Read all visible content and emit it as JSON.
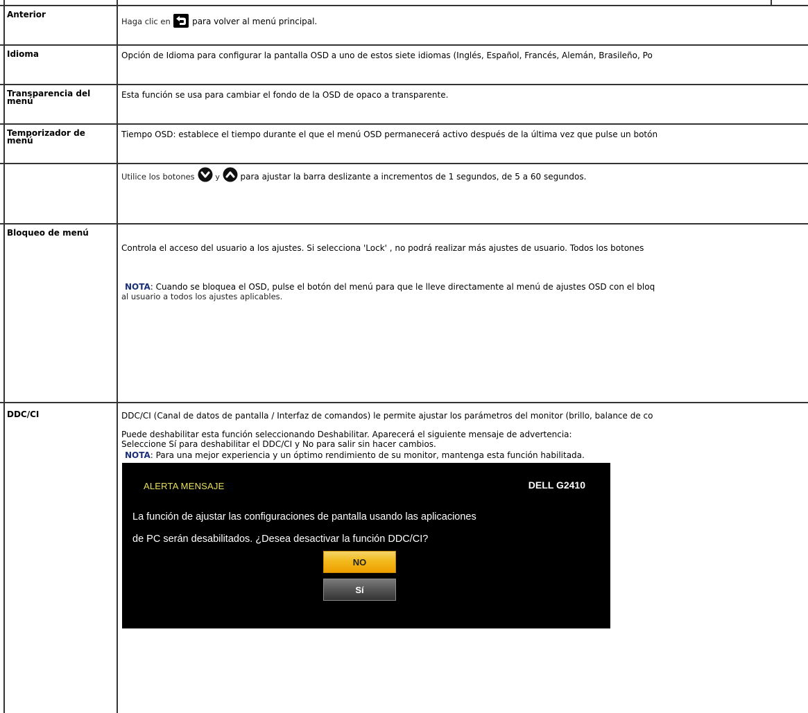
{
  "rows": {
    "anterior": {
      "label": "Anterior",
      "text_before": "Haga clic en",
      "text_after": "para volver al menú principal."
    },
    "idioma": {
      "label": "Idioma",
      "text": "Opción de Idioma para configurar la pantalla OSD a uno de estos siete idiomas (Inglés, Español, Francés, Alemán, Brasileño, Po"
    },
    "transparencia": {
      "label_line1": "Transparencia del",
      "label_line2": "menú",
      "text": "Esta función se usa para cambiar el fondo de la OSD de opaco a transparente."
    },
    "temporizador": {
      "label_line1": "Temporizador de",
      "label_line2": "menú",
      "text": "Tiempo OSD: establece el tiempo durante el que el menú OSD permanecerá activo después de la última vez que pulse un botón",
      "buttons_before": "Utilice los botones",
      "buttons_and": "y",
      "buttons_after": "para ajustar la barra deslizante a incrementos de 1 segundos, de 5 a 60 segundos."
    },
    "bloqueo": {
      "label": "Bloqueo de menú",
      "text": "Controla el acceso del usuario a los ajustes. Si selecciona 'Lock' , no podrá realizar más ajustes de usuario. Todos los botones",
      "note_keyword": "NOTA",
      "note_line1": ": Cuando se bloquea el OSD, pulse el botón del menú para que le lleve directamente al menú de ajustes OSD con el bloq",
      "note_line2": "al usuario a todos los ajustes aplicables."
    },
    "ddcci": {
      "label": "DDC/CI",
      "text": "DDC/CI (Canal de datos de pantalla / Interfaz de comandos) le permite ajustar los parámetros del monitor (brillo, balance de co",
      "disable_line1": "Puede deshabilitar esta función seleccionando Deshabilitar. Aparecerá el siguiente mensaje de advertencia:",
      "disable_line2": "Seleccione Sí para deshabilitar el DDC/CI y No para salir sin hacer cambios.",
      "note_keyword": "NOTA",
      "note_text": ": Para una mejor experiencia y un óptimo rendimiento de su monitor, mantenga esta función habilitada."
    }
  },
  "osd_dialog": {
    "title": "ALERTA MENSAJE",
    "model": "DELL G2410",
    "line1": "La función de ajustar las configuraciones de pantalla usando las aplicaciones",
    "line2": "de PC serán desabilitados. ¿Desea desactivar la función DDC/CI?",
    "no_button": "NO",
    "si_button": "Sí"
  },
  "icons": {
    "back": "back-arrow-icon",
    "down": "down-chevron-icon",
    "up": "up-chevron-icon"
  }
}
